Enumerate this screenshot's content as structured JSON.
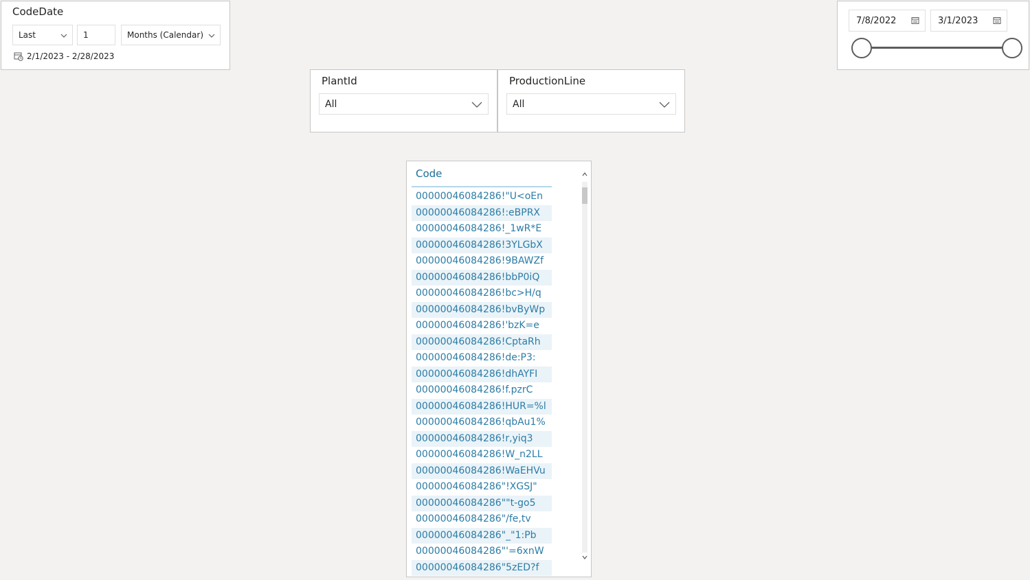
{
  "codedate": {
    "title": "CodeDate",
    "relative_mode": "Last",
    "relative_count": "1",
    "relative_unit": "Months (Calendar)",
    "range_text": "2/1/2023 - 2/28/2023"
  },
  "date_range": {
    "start": "7/8/2022",
    "end": "3/1/2023"
  },
  "plant": {
    "title": "PlantId",
    "value": "All"
  },
  "production_line": {
    "title": "ProductionLine",
    "value": "All"
  },
  "code_table": {
    "header": "Code",
    "rows": [
      "00000046084286!\"U<oEn",
      "00000046084286!:eBPRX",
      "00000046084286!_1wR*E",
      "00000046084286!3YLGbX",
      "00000046084286!9BAWZf",
      "00000046084286!bbP0iQ",
      "00000046084286!bc>H/q",
      "00000046084286!bvByWp",
      "00000046084286!'bzK=e",
      "00000046084286!CptaRh",
      "00000046084286!de:P3:",
      "00000046084286!dhAYFI",
      "00000046084286!f.pzrC",
      "00000046084286!HUR=%l",
      "00000046084286!qbAu1%",
      "00000046084286!r,yiq3",
      "00000046084286!W_n2LL",
      "00000046084286!WaEHVu",
      "00000046084286\"!XGSJ\"",
      "00000046084286\"\"t-go5",
      "00000046084286\"/fe,tv",
      "00000046084286\"_\"1:Pb",
      "00000046084286\"'=6xnW",
      "00000046084286\"5zED?f"
    ]
  },
  "colors": {
    "accent": "#1c6e99",
    "row_text": "#2c7ca6",
    "row_alt": "#eaf3f8",
    "slider": "#5c5c5c"
  },
  "icons": {
    "dropdown": "chevron-down-icon",
    "calendar": "calendar-icon",
    "range": "calendar-clock-icon"
  }
}
